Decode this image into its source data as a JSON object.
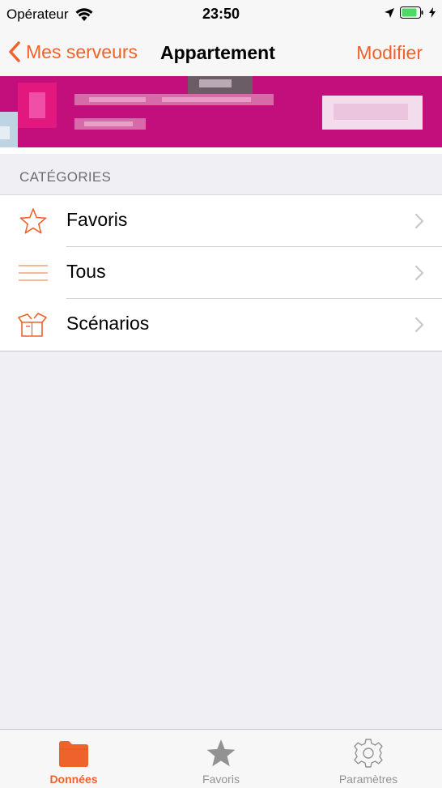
{
  "status_bar": {
    "carrier": "Opérateur",
    "time": "23:50"
  },
  "nav": {
    "back_label": "Mes serveurs",
    "title": "Appartement",
    "edit_label": "Modifier"
  },
  "colors": {
    "accent": "#f0622c",
    "banner": "#c30f7b",
    "background": "#efeff4"
  },
  "section": {
    "title": "CATÉGORIES"
  },
  "categories": [
    {
      "label": "Favoris",
      "icon": "star-outline-icon"
    },
    {
      "label": "Tous",
      "icon": "list-lines-icon"
    },
    {
      "label": "Scénarios",
      "icon": "open-box-icon"
    }
  ],
  "tabs": [
    {
      "label": "Données",
      "icon": "folder-icon",
      "active": true
    },
    {
      "label": "Favoris",
      "icon": "star-filled-icon",
      "active": false
    },
    {
      "label": "Paramètres",
      "icon": "gear-icon",
      "active": false
    }
  ]
}
